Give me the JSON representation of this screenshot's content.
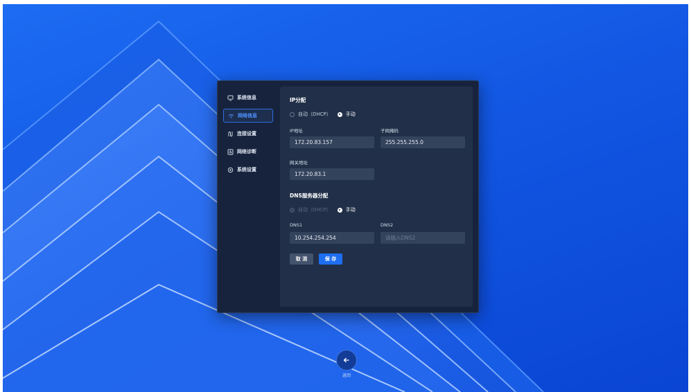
{
  "sidebar": {
    "items": [
      {
        "label": "系统信息",
        "icon": "monitor-icon",
        "active": false
      },
      {
        "label": "网络信息",
        "icon": "wifi-icon",
        "active": true
      },
      {
        "label": "连接设置",
        "icon": "connection-icon",
        "active": false
      },
      {
        "label": "网络诊断",
        "icon": "diagnostic-icon",
        "active": false
      },
      {
        "label": "系统设置",
        "icon": "settings-icon",
        "active": false
      }
    ]
  },
  "ip": {
    "title": "IP分配",
    "mode_auto": "自动（DHCP）",
    "mode_manual": "手动",
    "selected_mode": "手动",
    "ip_label": "IP地址",
    "ip_value": "172.20.83.157",
    "mask_label": "子网掩码",
    "mask_value": "255.255.255.0",
    "gateway_label": "网关地址",
    "gateway_value": "172.20.83.1"
  },
  "dns": {
    "title": "DNS服务器分配",
    "mode_auto": "自动（DHCP）",
    "mode_manual": "手动",
    "selected_mode": "手动",
    "dns1_label": "DNS1",
    "dns1_value": "10.254.254.254",
    "dns2_label": "DNS2",
    "dns2_placeholder": "请输入DNS2"
  },
  "actions": {
    "cancel_label": "取 消",
    "save_label": "保 存"
  },
  "footer": {
    "back_label": "返回"
  },
  "colors": {
    "accent": "#1e6ef0",
    "background": "#1257e3",
    "panel": "#17233d"
  }
}
